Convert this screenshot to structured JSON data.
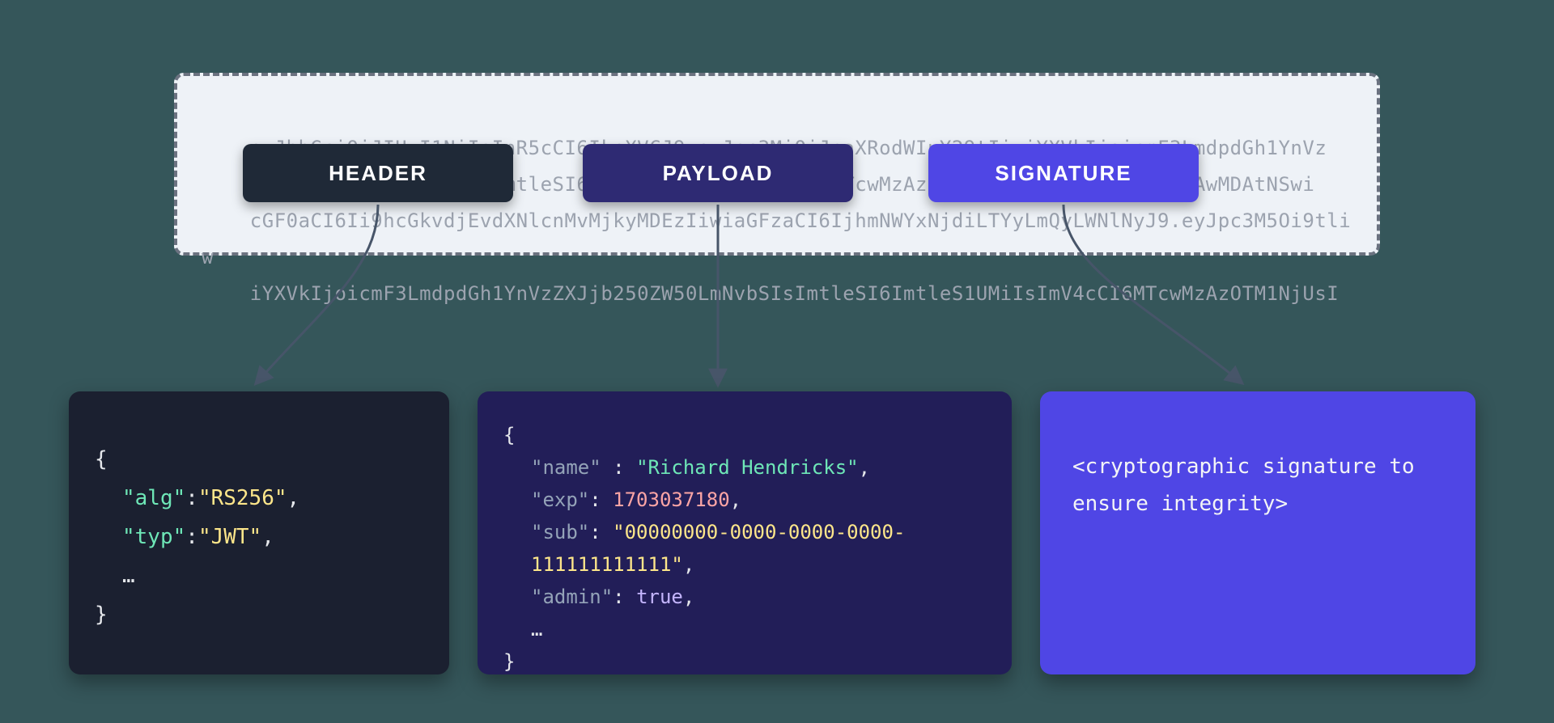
{
  "token": {
    "line1": "eyJhbGciOiJIUzI1NiIsInR5cCI6IkpXVCJ9.eyJpc3MiOiJnaXRodWIuY29tIiwiYXVkIjoicmF3LmdpdGh1YnVz",
    "line2": "ZXJjb250ZW50LmNvbSIsImtleSI6ImtleS1UMSIsImV4cCI6MTcwMzAzNzE4MCwic3ViIjoiMDAwMDAwMDAtNSwi",
    "line3": "cGF0aCI6Ii9hcGkvdjEvdXNlcnMvMjkyMDEzIiwiaGFzaCI6IjhmNWYxNjdiLTYyLmQyLWNlNyJ9.eyJpc3M5Oi9tliw",
    "line4": "iYXVkIjoicmF3LmdpdGh1YnVzZXJjb250ZW50LmNvbSIsImtleSI6ImtleS1UMiIsImV4cCI6MTcwMzAzOTM1NjUsI"
  },
  "labels": {
    "header": "HEADER",
    "payload": "PAYLOAD",
    "signature": "SIGNATURE"
  },
  "header_decoded": {
    "alg_key": "\"alg\"",
    "alg_val": "\"RS256\"",
    "typ_key": "\"typ\"",
    "typ_val": "\"JWT\"",
    "ellipsis": "…"
  },
  "payload_decoded": {
    "name_key": "\"name\"",
    "name_val": "\"Richard Hendricks\"",
    "exp_key": "\"exp\"",
    "exp_val": "1703037180",
    "sub_key": "\"sub\"",
    "sub_val": "\"00000000-0000-0000-0000-111111111111\"",
    "admin_key": "\"admin\"",
    "admin_val": "true",
    "ellipsis": "…"
  },
  "signature_text": "<cryptographic signature to ensure integrity>",
  "punct": {
    "open": "{",
    "close": "}",
    "colon": ":",
    "colon_sp": " : ",
    "comma": ","
  }
}
